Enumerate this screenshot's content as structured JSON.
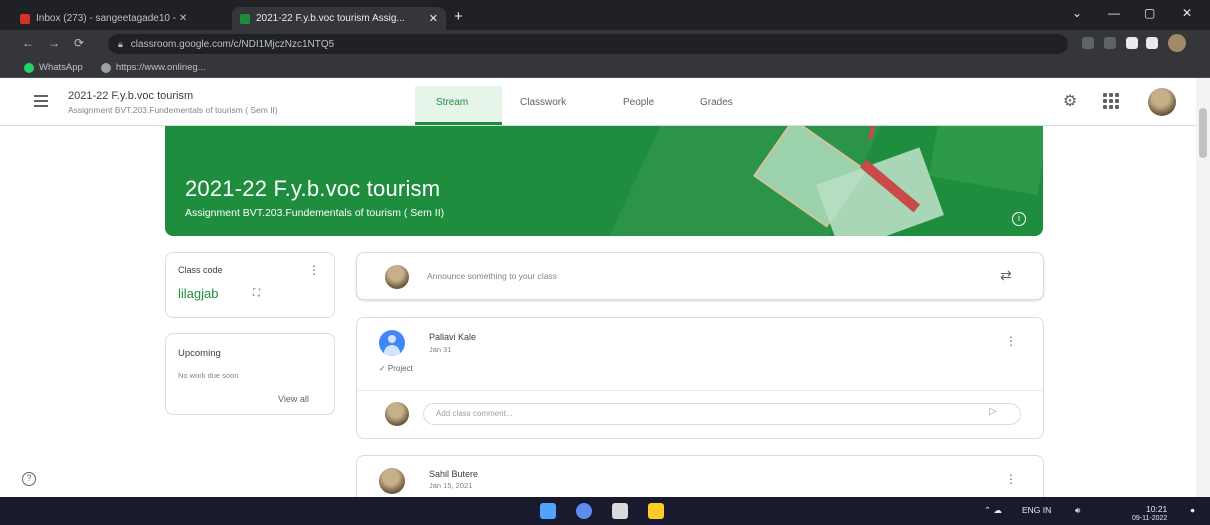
{
  "browser": {
    "tabs": [
      {
        "label": "Inbox (273) - sangeetagade10 - ✕",
        "favicon_color": "#d93025"
      },
      {
        "label": "2021-22 F.y.b.voc tourism Assig...",
        "favicon_color": "#1e8e3e"
      }
    ],
    "new_tab": "+",
    "url": "classroom.google.com/c/NDI1MjczNzc1NTQ5",
    "bookmarks": [
      {
        "label": "WhatsApp",
        "color": "#25d366"
      },
      {
        "label": "https://www.onlineg...",
        "color": "#9aa0a6"
      }
    ],
    "window_controls": [
      "⌄",
      "—",
      "▢",
      "✕"
    ]
  },
  "classroom": {
    "class_title": "2021-22 F.y.b.voc tourism",
    "class_subtitle": "Assignment BVT.203.Fundementals of tourism ( Sem II)",
    "tabs": [
      "Stream",
      "Classwork",
      "People",
      "Grades"
    ],
    "active_tab": "Stream",
    "accent_color": "#1e8e3e"
  },
  "banner": {
    "title": "2021-22 F.y.b.voc tourism",
    "subtitle": "Assignment BVT.203.Fundementals of tourism ( Sem II)"
  },
  "class_code": {
    "label": "Class code",
    "value": "lilagjab"
  },
  "upcoming": {
    "title": "Upcoming",
    "text": "No work due soon",
    "view_all": "View all"
  },
  "announce": {
    "placeholder": "Announce something to your class"
  },
  "posts": [
    {
      "author": "Pallavi Kale",
      "date": "Jan 31",
      "body": "✓ Project",
      "comment_placeholder": "Add class comment..."
    },
    {
      "author": "Sahil Butere",
      "date": "Jan 15, 2021"
    }
  ],
  "taskbar": {
    "tray_lang": "ENG IN",
    "tray_time": "10:21",
    "tray_date": "09-11-2022"
  }
}
